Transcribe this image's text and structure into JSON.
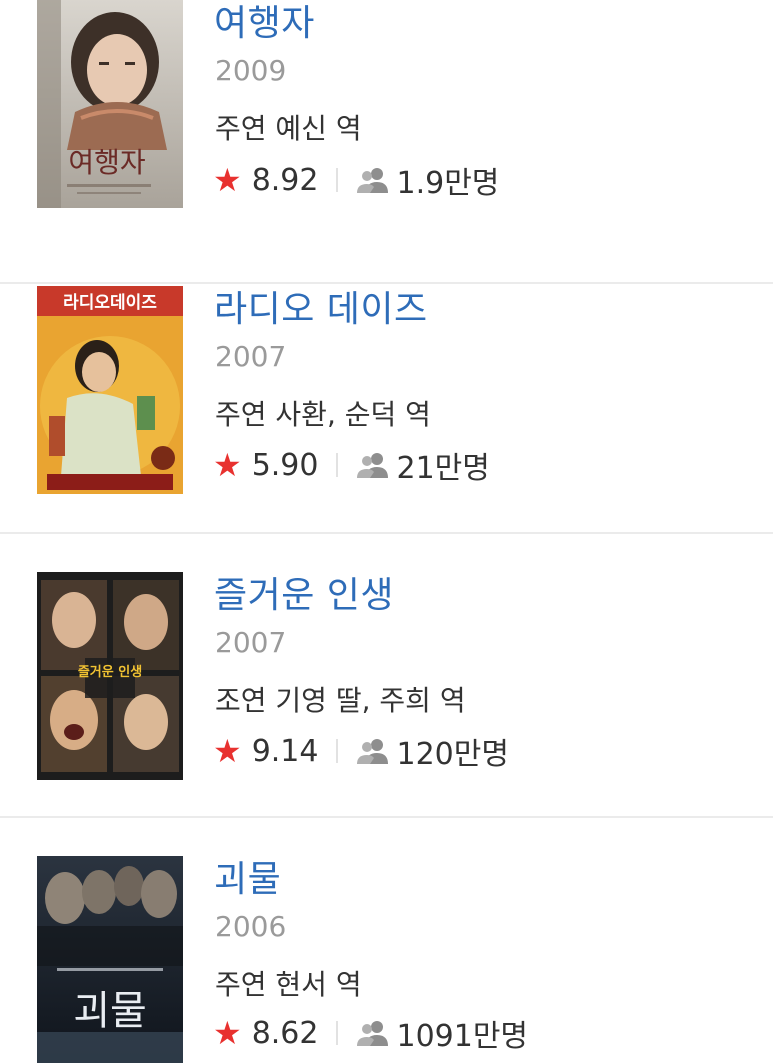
{
  "movies": [
    {
      "title": "여행자",
      "year": "2009",
      "role": "주연 예신 역",
      "rating": "8.92",
      "audience": "1.9만명",
      "poster": {
        "colors": {
          "bg": "#c9c4bc",
          "accent": "#8c6a55",
          "text": "#6b2a26"
        },
        "lettering": "여행자"
      }
    },
    {
      "title": "라디오 데이즈",
      "year": "2007",
      "role": "주연 사환, 순덕 역",
      "rating": "5.90",
      "audience": "21만명",
      "poster": {
        "colors": {
          "bg": "#e9a431",
          "accent": "#c8392a",
          "text": "#ffffff"
        },
        "lettering": "라디오데이즈"
      }
    },
    {
      "title": "즐거운 인생",
      "year": "2007",
      "role": "조연 기영 딸, 주희 역",
      "rating": "9.14",
      "audience": "120만명",
      "poster": {
        "colors": {
          "bg": "#1d1d1d",
          "accent": "#d6a94a",
          "text": "#f1c232"
        },
        "lettering": "즐거운 인생"
      }
    },
    {
      "title": "괴물",
      "year": "2006",
      "role": "주연 현서 역",
      "rating": "8.62",
      "audience": "1091만명",
      "poster": {
        "colors": {
          "bg": "#1e2632",
          "accent": "#5a6a7c",
          "text": "#e9edf2"
        },
        "lettering": "괴물"
      }
    }
  ],
  "icons": {
    "rating": "star-icon",
    "audience": "people-icon"
  },
  "colors": {
    "title": "#2e6cb8",
    "year": "#9a9a9a",
    "star": "#e8312f",
    "divider": "#ebebeb"
  }
}
